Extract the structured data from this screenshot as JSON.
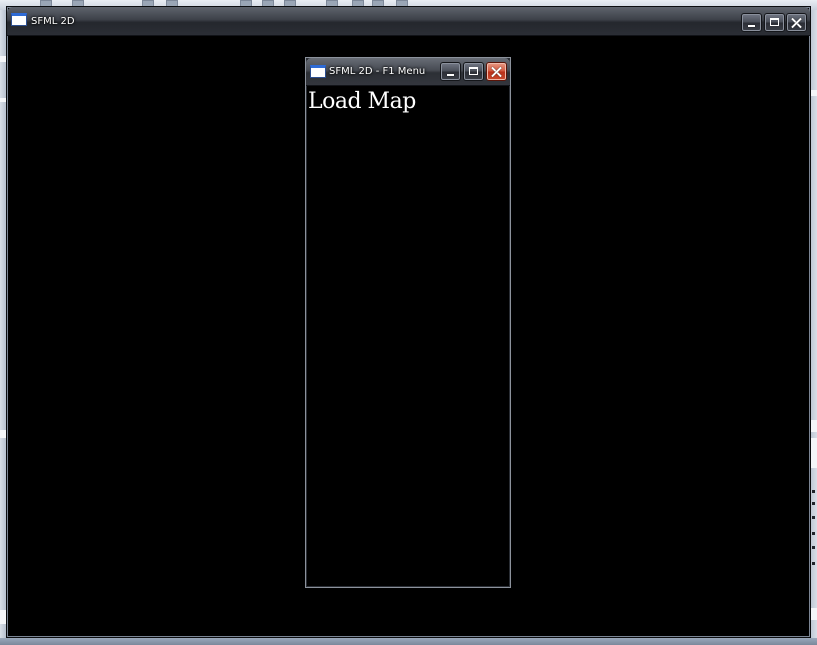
{
  "main_window": {
    "title": "SFML 2D",
    "icon": "sfml-window-icon",
    "buttons": {
      "minimize": "minimize-icon",
      "maximize": "maximize-icon",
      "close": "close-icon"
    }
  },
  "menu_window": {
    "title": "SFML 2D - F1 Menu",
    "icon": "sfml-window-icon",
    "buttons": {
      "minimize": "minimize-icon",
      "maximize": "maximize-icon",
      "close": "close-icon"
    },
    "items": [
      {
        "label": "Load Map"
      }
    ]
  },
  "colors": {
    "canvas": "#000000",
    "menu_text": "#ffffff",
    "close_button_active": "#d2563c",
    "titlebar_dark": "#2b2e35"
  }
}
